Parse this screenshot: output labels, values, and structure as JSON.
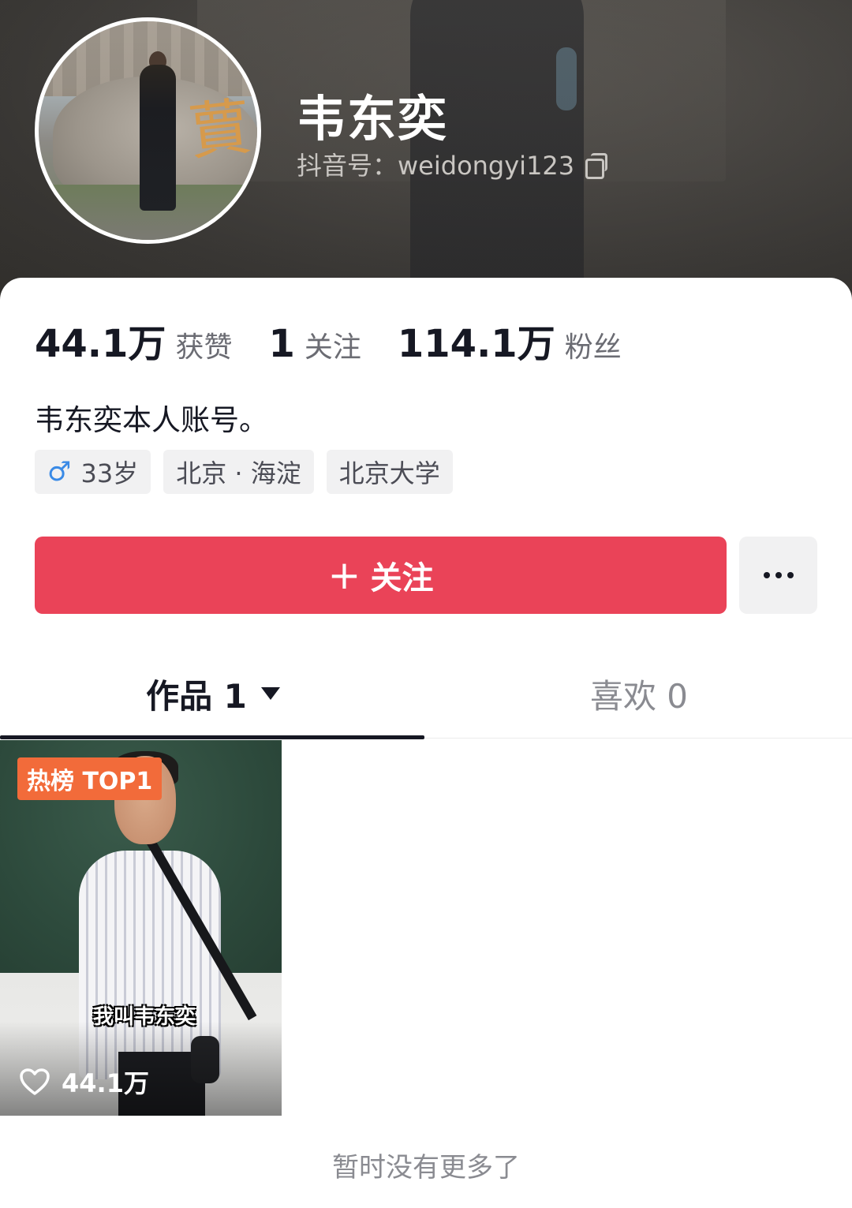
{
  "profile": {
    "name": "韦东奕",
    "douyin_id": "抖音号：weidongyi123"
  },
  "stats": [
    {
      "value": "44.1万",
      "label": "获赞"
    },
    {
      "value": "1",
      "label": "关注"
    },
    {
      "value": "114.1万",
      "label": "粉丝"
    }
  ],
  "bio": "韦东奕本人账号。",
  "tags": {
    "age": "33岁",
    "location": "北京 · 海淀",
    "school": "北京大学"
  },
  "actions": {
    "follow_label": "关注",
    "follow_plus": "+"
  },
  "tabs": {
    "works_label": "作品 1",
    "likes_label": "喜欢 0"
  },
  "video": {
    "badge": "热榜 TOP1",
    "caption": "我叫韦东奕",
    "likes": "44.1万"
  },
  "footer": {
    "no_more": "暂时没有更多了"
  },
  "colors": {
    "follow_button": "#ea4358",
    "hot_badge": "#f26b3a",
    "male_icon": "#3a8ae6"
  }
}
